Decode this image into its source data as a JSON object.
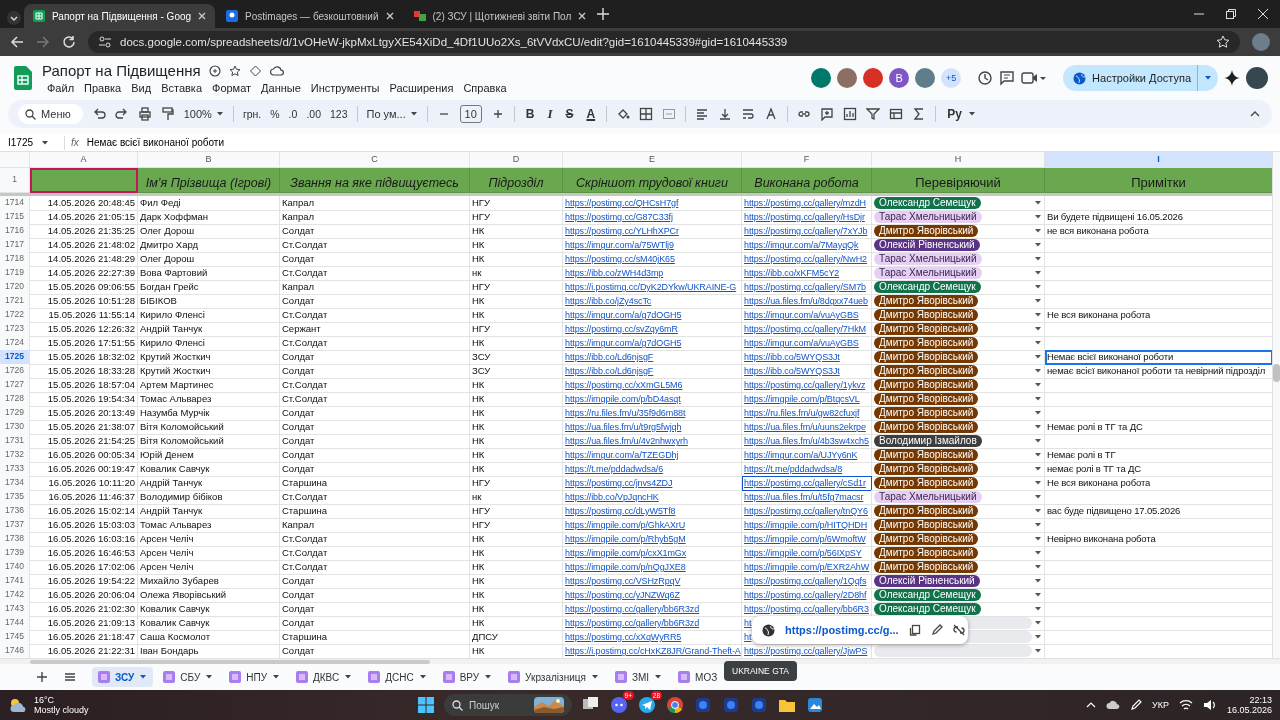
{
  "browser": {
    "tabs": [
      {
        "title": "Рапорт на Підвищення - Goog",
        "selected": true
      },
      {
        "title": "Postimages — безкоштовний",
        "selected": false
      },
      {
        "title": "(2) ЗСУ | Щотижневі звіти Пол",
        "selected": false
      }
    ],
    "address": "docs.google.com/spreadsheets/d/1vOHeW-jkpMxLtgyXE54XiDd_4Df1UUo2Xs_6tVVdxCU/edit?gid=1610445339#gid=1610445339"
  },
  "app": {
    "title": "Рапорт на Підвищення",
    "menus": [
      "Файл",
      "Правка",
      "Вид",
      "Вставка",
      "Формат",
      "Данные",
      "Инструменты",
      "Расширения",
      "Справка"
    ],
    "avatars": [
      {
        "color": "#00796b"
      },
      {
        "color": "#8d6e63"
      },
      {
        "color": "#d93025"
      },
      {
        "color": "#7e57c2",
        "letter": "В"
      },
      {
        "color": "#607d8b"
      }
    ],
    "more_count": "+5",
    "share_label": "Настройки Доступа"
  },
  "toolbar": {
    "search_label": "Меню",
    "zoom": "100%",
    "number_formats": [
      "грн.",
      "%",
      ".0",
      ".00",
      "123"
    ],
    "font": "По ум...",
    "font_size": "10",
    "style_buttons": [
      "B",
      "I",
      "S",
      "A"
    ],
    "input_tools": "Ру"
  },
  "formula_bar": {
    "cell_ref": "I1725",
    "fx": "fx",
    "value": "Немає всієї виконаної роботи"
  },
  "sheet": {
    "columns": [
      {
        "letter": "A",
        "selected": false
      },
      {
        "letter": "B",
        "selected": false
      },
      {
        "letter": "C",
        "selected": false
      },
      {
        "letter": "D",
        "selected": false
      },
      {
        "letter": "E",
        "selected": false
      },
      {
        "letter": "F",
        "selected": false
      },
      {
        "letter": "H",
        "selected": false
      },
      {
        "letter": "I",
        "selected": true
      }
    ],
    "header_row": {
      "number": "1",
      "first_cell_cursor": true,
      "titles": [
        "Ім’я Прізвища (Ігрові)",
        "Звання на яке підвищуєтесь",
        "Підрозділ",
        "Скріншот трудової книги",
        "Виконана робота",
        "Перевіряючий",
        "Примітки"
      ]
    },
    "rows": [
      {
        "number": "1714",
        "timestamp": "14.05.2026 20:48:45",
        "name": "Фил Феді",
        "rank": "Капрал",
        "unit": "НГУ",
        "screenshot_link": "https://postimg.cc/QHCsH7gf",
        "work_link": "https://postimg.cc/gallery/mzdH",
        "checker": {
          "name": "Олександр Семещук",
          "color": "#11734b"
        },
        "selected": false,
        "cursor": false
      },
      {
        "number": "1715",
        "timestamp": "14.05.2026 21:05:15",
        "name": "Дарк  Хоффман",
        "rank": "Капрал",
        "unit": "НГУ",
        "screenshot_link": "https://postimg.cc/G87C33fj",
        "work_link": "https://postimg.cc/gallery/HsDjr",
        "checker": {
          "name": "Тарас Хмельницький",
          "color": "#e6cff2"
        },
        "note": "Ви будете підвищені 16.05.2026",
        "selected": false,
        "cursor": false
      },
      {
        "number": "1716",
        "timestamp": "14.05.2026 21:35:25",
        "name": "Олег Дорош",
        "rank": "Солдат",
        "unit": "НК",
        "screenshot_link": "https://postimg.cc/YLHhXPCr",
        "work_link": "https://postimg.cc/gallery/7xYJb",
        "checker": {
          "name": "Дмитро Яворівський",
          "color": "#753800"
        },
        "note": "не вся виконана робота",
        "selected": false,
        "cursor": false
      },
      {
        "number": "1717",
        "timestamp": "14.05.2026 21:48:02",
        "name": "Дмитро Хард",
        "rank": "Ст.Солдат",
        "unit": "НК",
        "screenshot_link": "https://imgur.com/a/75WTlj9",
        "work_link": "https://imgur.com/a/7MayqQk",
        "checker": {
          "name": "Олексій Рівненський",
          "color": "#5a3286"
        },
        "selected": false,
        "cursor": false
      },
      {
        "number": "1718",
        "timestamp": "14.05.2026 21:48:29",
        "name": "Олег Дорош",
        "rank": "Солдат",
        "unit": "НК",
        "screenshot_link": "https://postimg.cc/sM40jK65",
        "work_link": "https://postimg.cc/gallery/NwH2",
        "checker": {
          "name": "Тарас Хмельницький",
          "color": "#e6cff2"
        },
        "selected": false,
        "cursor": false
      },
      {
        "number": "1719",
        "timestamp": "14.05.2026 22:27:39",
        "name": "Вова Фартовий",
        "rank": "Ст.Солдат",
        "unit": "нк",
        "screenshot_link": "https://ibb.co/zWH4d3mp",
        "work_link": "https://ibb.co/xKFM5cY2",
        "checker": {
          "name": "Тарас Хмельницький",
          "color": "#e6cff2"
        },
        "selected": false,
        "cursor": false
      },
      {
        "number": "1720",
        "timestamp": "15.05.2026 09:06:55",
        "name": "Богдан Грейс",
        "rank": "Капрал",
        "unit": "НГУ",
        "screenshot_link": "https://i.postimg.cc/DyK2DYkw/UKRAINE-G",
        "work_link": "https://postimg.cc/gallery/SM7b",
        "checker": {
          "name": "Олександр Семещук",
          "color": "#11734b"
        },
        "selected": false,
        "cursor": false
      },
      {
        "number": "1721",
        "timestamp": "15.05.2026 10:51:28",
        "name": "БІБІКОВ",
        "rank": "Солдат",
        "unit": "НК",
        "screenshot_link": "https://ibb.co/jZy4scTc",
        "work_link": "https://ua.files.fm/u/8dgxx74ueb",
        "checker": {
          "name": "Дмитро Яворівський",
          "color": "#753800"
        },
        "selected": false,
        "cursor": false
      },
      {
        "number": "1722",
        "timestamp": "15.05.2026 11:55:14",
        "name": "Кирило Фленсі",
        "rank": "Ст.Солдат",
        "unit": "НК",
        "screenshot_link": "https://imgur.com/a/g7dOGH5",
        "work_link": "https://imgur.com/a/vuAyGBS",
        "checker": {
          "name": "Дмитро Яворівський",
          "color": "#753800"
        },
        "note": "Не вся виконана робота",
        "selected": false,
        "cursor": false
      },
      {
        "number": "1723",
        "timestamp": "15.05.2026 12:26:32",
        "name": "Андрій Танчук",
        "rank": "Сержант",
        "unit": "НГУ",
        "screenshot_link": "https://postimg.cc/svZqy6mR",
        "work_link": "https://postimg.cc/gallery/7HkM",
        "checker": {
          "name": "Дмитро Яворівський",
          "color": "#753800"
        },
        "selected": false,
        "cursor": false
      },
      {
        "number": "1724",
        "timestamp": "15.05.2026 17:51:55",
        "name": "Кирило Фленсі",
        "rank": "Ст.Солдат",
        "unit": "НК",
        "screenshot_link": "https://imgur.com/a/g7dOGH5",
        "work_link": "https://imgur.com/a/vuAyGBS",
        "checker": {
          "name": "Дмитро Яворівський",
          "color": "#753800"
        },
        "selected": false,
        "cursor": false
      },
      {
        "number": "1725",
        "timestamp": "15.05.2026 18:32:02",
        "name": "Крутий Жосткич",
        "rank": "Солдат",
        "unit": "ЗСУ",
        "screenshot_link": "https://ibb.co/Ld6njsgF",
        "work_link": "https://ibb.co/5WYQS3Jt",
        "checker": {
          "name": "Дмитро Яворівський",
          "color": "#753800"
        },
        "note": "Немає всієї виконаної роботи",
        "selected": true,
        "cursor": false
      },
      {
        "number": "1726",
        "timestamp": "15.05.2026 18:33:28",
        "name": "Крутий Жосткич",
        "rank": "Солдат",
        "unit": "ЗСУ",
        "screenshot_link": "https://ibb.co/Ld6njsgF",
        "work_link": "https://ibb.co/5WYQS3Jt",
        "checker": {
          "name": "Дмитро Яворівський",
          "color": "#753800"
        },
        "note": "немає всієї виконаної роботи та невірний підрозділ",
        "selected": false,
        "cursor": false
      },
      {
        "number": "1727",
        "timestamp": "15.05.2026 18:57:04",
        "name": "Артем Мартинес",
        "rank": "Ст.Солдат",
        "unit": "НК",
        "screenshot_link": "https://postimg.cc/xXmGL5M6",
        "work_link": "https://postimg.cc/gallery/1ykvz",
        "checker": {
          "name": "Дмитро Яворівський",
          "color": "#753800"
        },
        "selected": false,
        "cursor": false
      },
      {
        "number": "1728",
        "timestamp": "15.05.2026 19:54:34",
        "name": "Томас Альварез",
        "rank": "Ст.Солдат",
        "unit": "НК",
        "screenshot_link": "https://imgpile.com/p/bD4asqt",
        "work_link": "https://imgpile.com/p/BtqcsVL",
        "checker": {
          "name": "Дмитро Яворівський",
          "color": "#753800"
        },
        "selected": false,
        "cursor": false
      },
      {
        "number": "1729",
        "timestamp": "15.05.2026 20:13:49",
        "name": "Назумба Мурчік",
        "rank": "Солдат",
        "unit": "НК",
        "screenshot_link": "https://ru.files.fm/u/35f9d6m88t",
        "work_link": "https://ru.files.fm/u/gw82cfuxjf",
        "checker": {
          "name": "Дмитро Яворівський",
          "color": "#753800"
        },
        "selected": false,
        "cursor": false
      },
      {
        "number": "1730",
        "timestamp": "15.05.2026 21:38:07",
        "name": "Вітя Коломойський",
        "rank": "Солдат",
        "unit": "НК",
        "screenshot_link": "https://ua.files.fm/u/t9rg5fwjqh",
        "work_link": "https://ua.files.fm/u/uuns2ekrpe",
        "checker": {
          "name": "Дмитро Яворівський",
          "color": "#753800"
        },
        "note": "Немає ролі в ТГ та ДС",
        "selected": false,
        "cursor": false
      },
      {
        "number": "1731",
        "timestamp": "15.05.2026 21:54:25",
        "name": "Вітя Коломойський",
        "rank": "Солдат",
        "unit": "НК",
        "screenshot_link": "https://ua.files.fm/u/4v2nhwxyrh",
        "work_link": "https://ua.files.fm/u/4b3sw4xch5",
        "checker": {
          "name": "Володимир Ізмайлов",
          "color": "#3d3d3d"
        },
        "selected": false,
        "cursor": false
      },
      {
        "number": "1732",
        "timestamp": "16.05.2026 00:05:34",
        "name": "Юрій Денем",
        "rank": "Солдат",
        "unit": "НК",
        "screenshot_link": "https://imgur.com/a/TZEGDhj",
        "work_link": "https://imgur.com/a/UJYy6nK",
        "checker": {
          "name": "Дмитро Яворівський",
          "color": "#753800"
        },
        "note": "Немає ролі в ТГ",
        "selected": false,
        "cursor": false
      },
      {
        "number": "1733",
        "timestamp": "16.05.2026 00:19:47",
        "name": "Ковалик Савчук",
        "rank": "Солдат",
        "unit": "НК",
        "screenshot_link": "https://t.me/pddadwdsa/6",
        "work_link": "https://t.me/pddadwdsa/8",
        "checker": {
          "name": "Дмитро Яворівський",
          "color": "#753800"
        },
        "note": "немає ролі в ТГ та ДС",
        "selected": false,
        "cursor": false
      },
      {
        "number": "1734",
        "timestamp": "16.05.2026 10:11:20",
        "name": "Андрій Танчук",
        "rank": "Старшина",
        "unit": "НГУ",
        "screenshot_link": "https://postimg.cc/jnvs4ZDJ",
        "work_link": "https://postimg.cc/gallery/cSd1r",
        "checker": {
          "name": "Дмитро Яворівський",
          "color": "#753800"
        },
        "note": "Не вся виконана робота",
        "selected": false,
        "cursor": true
      },
      {
        "number": "1735",
        "timestamp": "16.05.2026 11:46:37",
        "name": "Володимир бібіков",
        "rank": "Ст.Солдат",
        "unit": "нк",
        "screenshot_link": "https://ibb.co/VpJqncHK",
        "work_link": "https://ua.files.fm/u/t5fg7macsr",
        "checker": {
          "name": "Тарас Хмельницький",
          "color": "#e6cff2"
        },
        "selected": false,
        "cursor": false
      },
      {
        "number": "1736",
        "timestamp": "16.05.2026 15:02:14",
        "name": "Андрій Танчук",
        "rank": "Старшина",
        "unit": "НГУ",
        "screenshot_link": "https://postimg.cc/dLyW5Tf8",
        "work_link": "https://postimg.cc/gallery/tnQY6",
        "checker": {
          "name": "Дмитро Яворівський",
          "color": "#753800"
        },
        "note": "вас буде підвищено 17.05.2026",
        "selected": false,
        "cursor": false
      },
      {
        "number": "1737",
        "timestamp": "16.05.2026 15:03:03",
        "name": "Томас Альварез",
        "rank": "Капрал",
        "unit": "НГУ",
        "screenshot_link": "https://imgpile.com/p/GhkAXrU",
        "work_link": "https://imgpile.com/p/HITQHDH",
        "checker": {
          "name": "Дмитро Яворівський",
          "color": "#753800"
        },
        "selected": false,
        "cursor": false
      },
      {
        "number": "1738",
        "timestamp": "16.05.2026 16:03:16",
        "name": "Арсен Челіч",
        "rank": "Ст.Солдат",
        "unit": "НК",
        "screenshot_link": "https://imgpile.com/p/Rhyb5gM",
        "work_link": "https://imgpile.com/p/6WmoftW",
        "checker": {
          "name": "Дмитро Яворівський",
          "color": "#753800"
        },
        "note": "Невірно виконана робота",
        "selected": false,
        "cursor": false
      },
      {
        "number": "1739",
        "timestamp": "16.05.2026 16:46:53",
        "name": "Арсен Челіч",
        "rank": "Ст.Солдат",
        "unit": "НК",
        "screenshot_link": "https://imgpile.com/p/cxX1mGx",
        "work_link": "https://imgpile.com/p/56IXpSY",
        "checker": {
          "name": "Дмитро Яворівський",
          "color": "#753800"
        },
        "selected": false,
        "cursor": false
      },
      {
        "number": "1740",
        "timestamp": "16.05.2026 17:02:06",
        "name": "Арсен Челіч",
        "rank": "Ст.Солдат",
        "unit": "НК",
        "screenshot_link": "https://imgpile.com/p/nQgJXE8",
        "work_link": "https://imgpile.com/p/EXR2AhW",
        "checker": {
          "name": "Дмитро Яворівський",
          "color": "#753800"
        },
        "selected": false,
        "cursor": false
      },
      {
        "number": "1741",
        "timestamp": "16.05.2026 19:54:22",
        "name": "Михайло Зубарев",
        "rank": "Солдат",
        "unit": "НК",
        "screenshot_link": "https://postimg.cc/VSHzRpqV",
        "work_link": "https://postimg.cc/gallery/1Qqfs",
        "checker": {
          "name": "Олексій Рівненський",
          "color": "#5a3286"
        },
        "selected": false,
        "cursor": false
      },
      {
        "number": "1742",
        "timestamp": "16.05.2026 20:06:04",
        "name": "Олежа Яворівський",
        "rank": "Солдат",
        "unit": "НК",
        "screenshot_link": "https://postimg.cc/yJNZWq6Z",
        "work_link": "https://postimg.cc/gallery/2D8hf",
        "checker": {
          "name": "Олександр Семещук",
          "color": "#11734b"
        },
        "selected": false,
        "cursor": false
      },
      {
        "number": "1743",
        "timestamp": "16.05.2026 21:02:30",
        "name": "Ковалик Савчук",
        "rank": "Солдат",
        "unit": "НК",
        "screenshot_link": "https://postimg.cc/gallery/bb6R3zd",
        "work_link": "https://postimg.cc/gallery/bb6R3",
        "checker": {
          "name": "Олександр Семещук",
          "color": "#11734b"
        },
        "selected": false,
        "cursor": false
      },
      {
        "number": "1744",
        "timestamp": "16.05.2026 21:09:13",
        "name": "Ковалик Савчук",
        "rank": "Солдат",
        "unit": "НК",
        "screenshot_link": "https://postimg.cc/gallery/bb6R3zd",
        "work_link": "ht",
        "checker": {
          "color": "#e8eaed"
        },
        "selected": false,
        "cursor": false
      },
      {
        "number": "1745",
        "timestamp": "16.05.2026 21:18:47",
        "name": "Саша Космолот",
        "rank": "Старшина",
        "unit": "ДПСУ",
        "screenshot_link": "https://postimg.cc/xXqWyRR5",
        "work_link": "ht",
        "checker": {
          "color": "#e8eaed"
        },
        "selected": false,
        "cursor": false
      },
      {
        "number": "1746",
        "timestamp": "16.05.2026 21:22:31",
        "name": "Іван Бондарь",
        "rank": "Солдат",
        "unit": "НК",
        "screenshot_link": "https://i.postimg.cc/cHxKZ8JR/Grand-Theft-A",
        "work_link": "https://postimg.cc/gallery/JjwPS",
        "checker": {
          "color": "#e8eaed"
        },
        "selected": false,
        "cursor": false
      }
    ]
  },
  "link_popup": {
    "url": "https://postimg.cc/g..."
  },
  "sheet_tabs": [
    {
      "name": "ЗСУ",
      "selected": true
    },
    {
      "name": "СБУ",
      "selected": false
    },
    {
      "name": "НПУ",
      "selected": false
    },
    {
      "name": "ДКВС",
      "selected": false
    },
    {
      "name": "ДСНС",
      "selected": false
    },
    {
      "name": "ВРУ",
      "selected": false
    },
    {
      "name": "Укрзалізниця",
      "selected": false
    },
    {
      "name": "ЗМІ",
      "selected": false
    },
    {
      "name": "МОЗ",
      "selected": false
    }
  ],
  "tooltip": "UKRAINE GTA",
  "taskbar": {
    "temperature": "16°C",
    "weather": "Mostly cloudy",
    "search_placeholder": "Пошук",
    "apps": [
      {
        "kind": "taskview"
      },
      {
        "kind": "discord",
        "badge": "9+"
      },
      {
        "kind": "telegram",
        "badge": "28"
      },
      {
        "kind": "chrome"
      },
      {
        "kind": "app"
      },
      {
        "kind": "app"
      },
      {
        "kind": "app"
      },
      {
        "kind": "folder"
      },
      {
        "kind": "photos"
      }
    ],
    "language": "УКР",
    "time": "22:13",
    "date": "16.05.2026"
  }
}
